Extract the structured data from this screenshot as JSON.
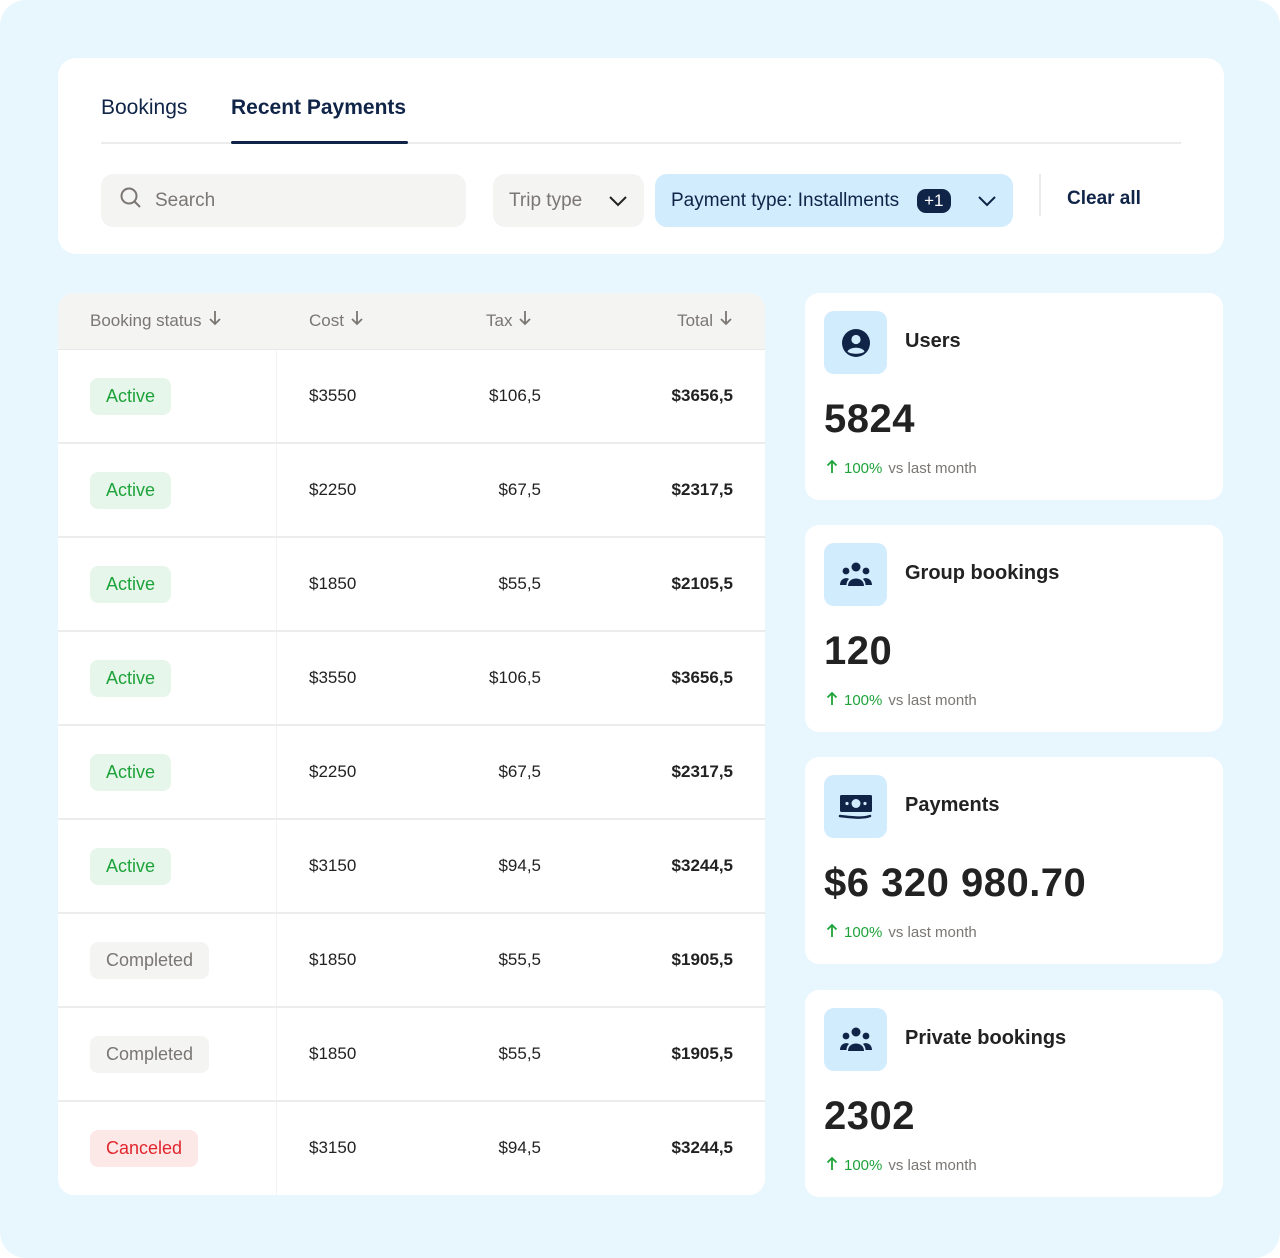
{
  "tabs": [
    {
      "label": "Bookings",
      "active": false
    },
    {
      "label": "Recent Payments",
      "active": true
    }
  ],
  "filters": {
    "search_placeholder": "Search",
    "trip_type_label": "Trip type",
    "payment_type_label": "Payment type: Installments",
    "payment_type_extra_count": "+1",
    "clear_all_label": "Clear all"
  },
  "table": {
    "headers": [
      "Booking status",
      "Cost",
      "Tax",
      "Total"
    ],
    "rows": [
      {
        "status": "Active",
        "status_type": "active",
        "cost": "$3550",
        "tax": "$106,5",
        "total": "$3656,5"
      },
      {
        "status": "Active",
        "status_type": "active",
        "cost": "$2250",
        "tax": "$67,5",
        "total": "$2317,5"
      },
      {
        "status": "Active",
        "status_type": "active",
        "cost": "$1850",
        "tax": "$55,5",
        "total": "$2105,5"
      },
      {
        "status": "Active",
        "status_type": "active",
        "cost": "$3550",
        "tax": "$106,5",
        "total": "$3656,5"
      },
      {
        "status": "Active",
        "status_type": "active",
        "cost": "$2250",
        "tax": "$67,5",
        "total": "$2317,5"
      },
      {
        "status": "Active",
        "status_type": "active",
        "cost": "$3150",
        "tax": "$94,5",
        "total": "$3244,5"
      },
      {
        "status": "Completed",
        "status_type": "completed",
        "cost": "$1850",
        "tax": "$55,5",
        "total": "$1905,5"
      },
      {
        "status": "Completed",
        "status_type": "completed",
        "cost": "$1850",
        "tax": "$55,5",
        "total": "$1905,5"
      },
      {
        "status": "Canceled",
        "status_type": "canceled",
        "cost": "$3150",
        "tax": "$94,5",
        "total": "$3244,5"
      }
    ]
  },
  "stats": [
    {
      "title": "Users",
      "icon": "user-circle-icon",
      "value": "5824",
      "change_pct": "100%",
      "change_text": "vs last month"
    },
    {
      "title": "Group bookings",
      "icon": "group-icon",
      "value": "120",
      "change_pct": "100%",
      "change_text": "vs last month"
    },
    {
      "title": "Payments",
      "icon": "money-icon",
      "value": "$6 320 980.70",
      "change_pct": "100%",
      "change_text": "vs last month"
    },
    {
      "title": "Private bookings",
      "icon": "group-icon",
      "value": "2302",
      "change_pct": "100%",
      "change_text": "vs last month"
    }
  ],
  "colors": {
    "background": "#e8f6fe",
    "navy": "#102448",
    "accent_light": "#d1ecfd",
    "active_green": "#1ea33b",
    "canceled_red": "#e0262c"
  }
}
